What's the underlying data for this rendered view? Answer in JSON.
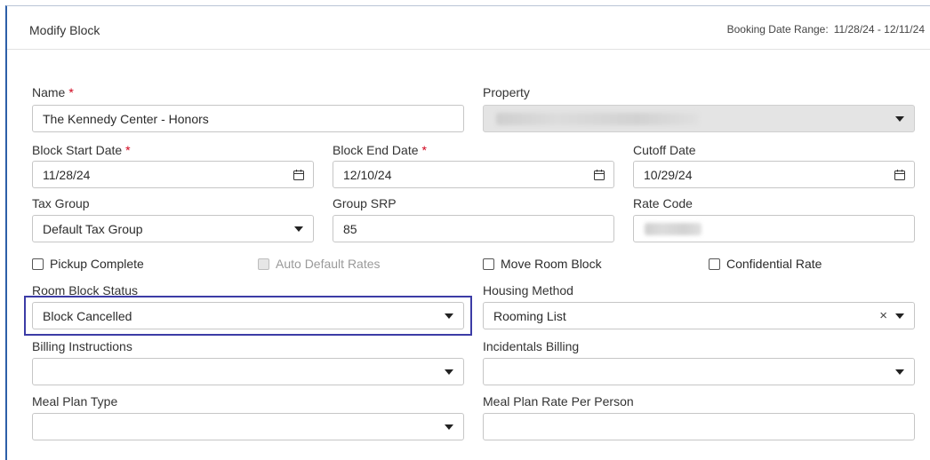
{
  "header": {
    "title": "Modify Block",
    "range_label": "Booking Date Range:",
    "range_value": "11/28/24 - 12/11/24"
  },
  "fields": {
    "name": {
      "label": "Name",
      "required": "*",
      "value": "The Kennedy Center - Honors"
    },
    "property": {
      "label": "Property",
      "value": ""
    },
    "block_start": {
      "label": "Block Start Date",
      "required": "*",
      "value": "11/28/24"
    },
    "block_end": {
      "label": "Block End Date",
      "required": "*",
      "value": "12/10/24"
    },
    "cutoff": {
      "label": "Cutoff Date",
      "value": "10/29/24"
    },
    "tax_group": {
      "label": "Tax Group",
      "value": "Default Tax Group"
    },
    "group_srp": {
      "label": "Group SRP",
      "value": "85"
    },
    "rate_code": {
      "label": "Rate Code",
      "value": ""
    },
    "room_block_status": {
      "label": "Room Block Status",
      "value": "Block Cancelled"
    },
    "housing_method": {
      "label": "Housing Method",
      "value": "Rooming List"
    },
    "billing_instructions": {
      "label": "Billing Instructions",
      "value": ""
    },
    "incidentals_billing": {
      "label": "Incidentals Billing",
      "value": ""
    },
    "meal_plan_type": {
      "label": "Meal Plan Type",
      "value": ""
    },
    "meal_plan_rate": {
      "label": "Meal Plan Rate Per Person",
      "value": ""
    }
  },
  "checkboxes": {
    "pickup_complete": {
      "label": "Pickup Complete",
      "checked": false
    },
    "auto_default_rates": {
      "label": "Auto Default Rates",
      "checked": false,
      "disabled": true
    },
    "move_room_block": {
      "label": "Move Room Block",
      "checked": false
    },
    "confidential_rate": {
      "label": "Confidential Rate",
      "checked": false
    }
  },
  "icons": {
    "clear": "×",
    "calendar": "calendar-icon",
    "dropdown": "caret-down-icon"
  },
  "colors": {
    "required": "#d0021b",
    "highlight": "#3c3ca6",
    "frame_accent": "#2d5fa8",
    "disabled_bg": "#e4e4e4"
  }
}
